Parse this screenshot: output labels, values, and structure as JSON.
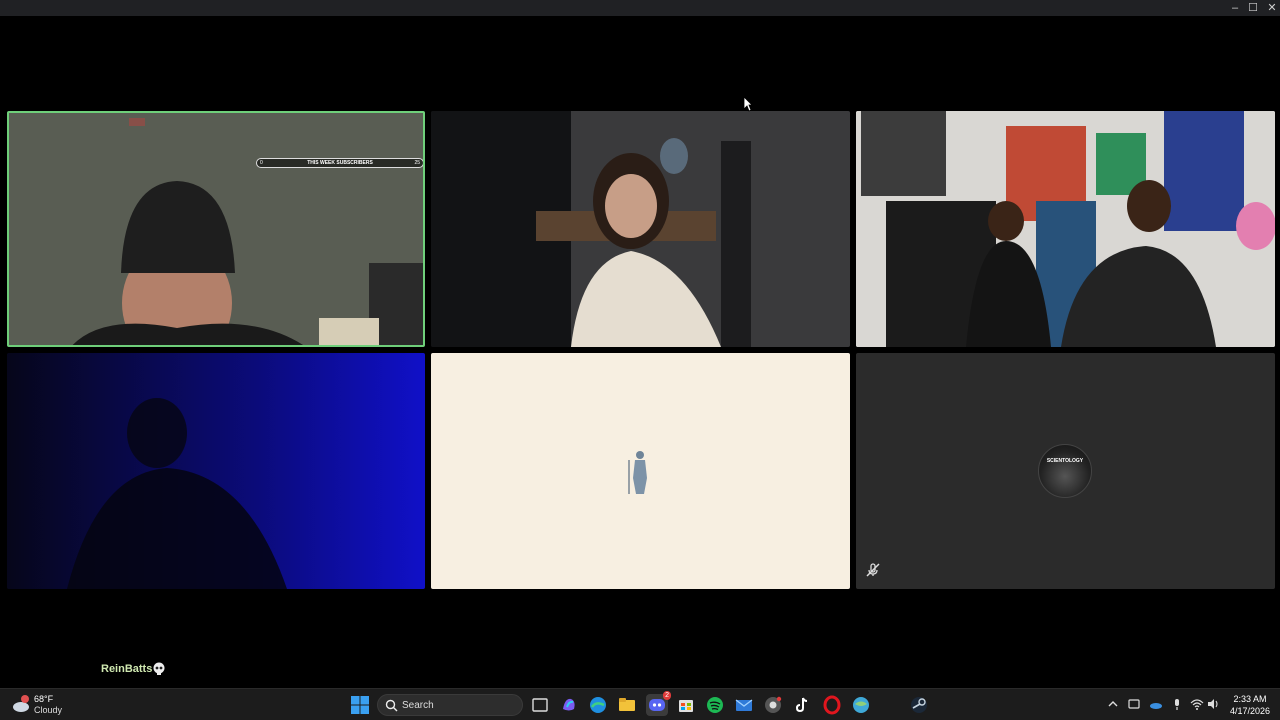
{
  "window": {
    "minimize_glyph": "–",
    "maximize_glyph": "☐",
    "close_glyph": "✕"
  },
  "tiles": {
    "tile1": {
      "subscriber_bar": {
        "left": "0",
        "label": "THIS WEEK SUBSCRIBERS",
        "right": "25"
      },
      "speaking": true,
      "speaking_color": "#6fcf7a"
    },
    "tile6": {
      "avatar_text": "SCIENTOLOGY",
      "muted": true
    }
  },
  "user": {
    "name": "ReinBatts"
  },
  "taskbar": {
    "weather": {
      "temp": "68°F",
      "desc": "Cloudy"
    },
    "search_label": "Search",
    "apps": [
      "task-view",
      "copilot",
      "edge",
      "file-explorer",
      "discord",
      "microsoft-store",
      "spotify",
      "mail",
      "chrome",
      "tiktok",
      "opera",
      "browser",
      "steam"
    ],
    "discord_badge": "2",
    "clock": {
      "time": "2:33 AM",
      "date": "4/17/2026"
    }
  },
  "colors": {
    "discord": "#5865f2",
    "spotify": "#1db954",
    "edge": "#1f8fe0",
    "opera": "#e0161e",
    "accent": "#6fcf7a"
  }
}
